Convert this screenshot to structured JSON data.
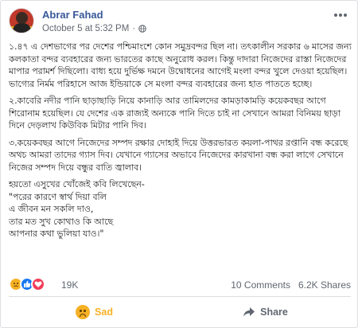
{
  "post": {
    "author": "Abrar Fahad",
    "timestamp": "October 5 at 5:32 PM",
    "separator": "·",
    "privacy_icon": "globe-icon",
    "more_icon": "ellipsis-icon",
    "paragraphs": [
      "১.৪৭ এ দেশভাগের পর দেশের পশ্চিমাংশে কোন সমুদ্রবন্দর ছিল না। তৎকালীন সরকার ৬ মাসের জন্য কলকাতা বন্দর ব্যবহারের জন্য ভারতের কাছে অনুরোধ করল। কিন্তু দাদারা নিজেদের রাস্তা নিজেদের মাপার পরামর্শ দিছিলো। বাধ্য হয়ে দুর্ভিক্ষ দমনে উদ্বোধনের আগেই মংলা বন্দর খুলে দেওয়া হয়েছিল। ভাগ্যের নির্মম পরিহাসে আজ ইন্ডিয়াকে সে মংলা বন্দর ব্যবহারের জন্য হাত পাততে হচ্ছে।",
      "২.কাবেরি নদীর পানি ছাড়াছাড়ি নিয়ে কানাড়ি আর তামিলদের কামড়াকামড়ি কয়েকবছর আগে শিরোনাম হয়েছিল। যে দেশের এক রাজ্যই অন্যকে পানি দিতে চাই না সেখানে আমরা বিনিময় ছাড়া দিনে দেড়লাখ কিউবিক মিটার পানি দিব।",
      "৩.কয়েকবছর আগে নিজেদের সম্পদ রক্ষার দোহাই দিয়ে উত্তরভারত কয়লা-পাথর রপ্তানি বন্ধ করেছে অথচ আমরা তাদের গ্যাস দিব। যেখানে গ্যাসের অভাবে নিজেদের কারখানা বন্ধ করা লাগে সেখানে নিজের সম্পদ দিয়ে বন্ধুর বাতি জ্বালাব।"
    ],
    "poem_intro": "হয়তো এসুখের খোঁজেই কবি লিখেছেন-",
    "poem_lines": [
      "\"পরের কারণে স্বার্থ দিয়া বলি",
      "এ জীবন মন সকলি দাও,",
      "তার মত সুখ কোথাও কি আছে",
      "আপনার কথা ভুলিয়া যাও।\""
    ]
  },
  "stats": {
    "reaction_icons": [
      "sad-icon",
      "like-icon",
      "love-icon"
    ],
    "reaction_count": "19K",
    "comments": "10 Comments",
    "shares": "6.2K Shares"
  },
  "actions": {
    "reaction_label": "Sad",
    "share_label": "Share"
  },
  "colors": {
    "author_link": "#385898",
    "sad_yellow": "#f7b125",
    "like_blue": "#1877f2",
    "love_red": "#f33e58",
    "meta_grey": "#616770"
  }
}
